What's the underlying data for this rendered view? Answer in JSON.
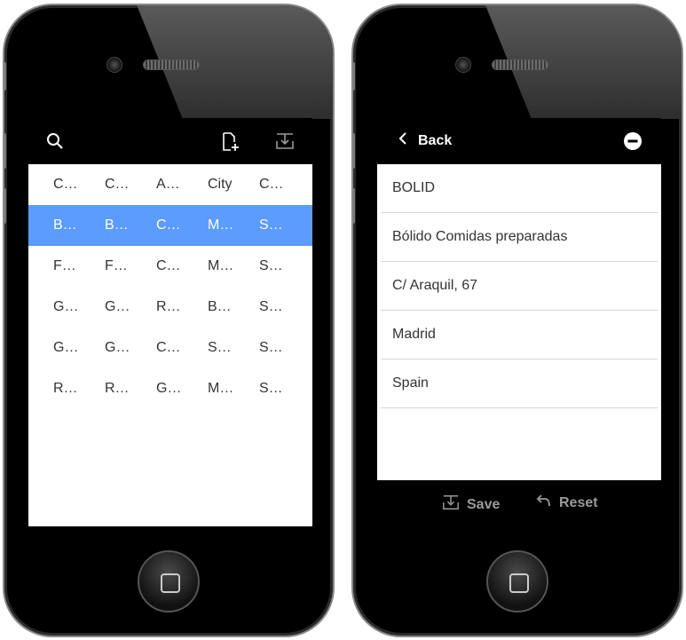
{
  "left": {
    "grid": {
      "rows": [
        [
          "C…",
          "C…",
          "A…",
          "City",
          "C…"
        ],
        [
          "B…",
          "B…",
          "C…",
          "M…",
          "S…"
        ],
        [
          "F…",
          "F…",
          "C…",
          "M…",
          "S…"
        ],
        [
          "G…",
          "G…",
          "R…",
          "B…",
          "S…"
        ],
        [
          "G…",
          "G…",
          "C…",
          "S…",
          "S…"
        ],
        [
          "R…",
          "R…",
          "G…",
          "M…",
          "S…"
        ]
      ],
      "selected_row": 1
    },
    "icons": [
      "search-icon",
      "new-document-icon",
      "download-icon"
    ]
  },
  "right": {
    "header": {
      "back_label": "Back"
    },
    "fields": [
      "BOLID",
      "Bólido Comidas preparadas",
      "C/ Araquil, 67",
      "Madrid",
      "Spain"
    ],
    "actions": {
      "save_label": "Save",
      "reset_label": "Reset"
    }
  },
  "colors": {
    "selection": "#5c9bff",
    "bar": "#000000"
  }
}
